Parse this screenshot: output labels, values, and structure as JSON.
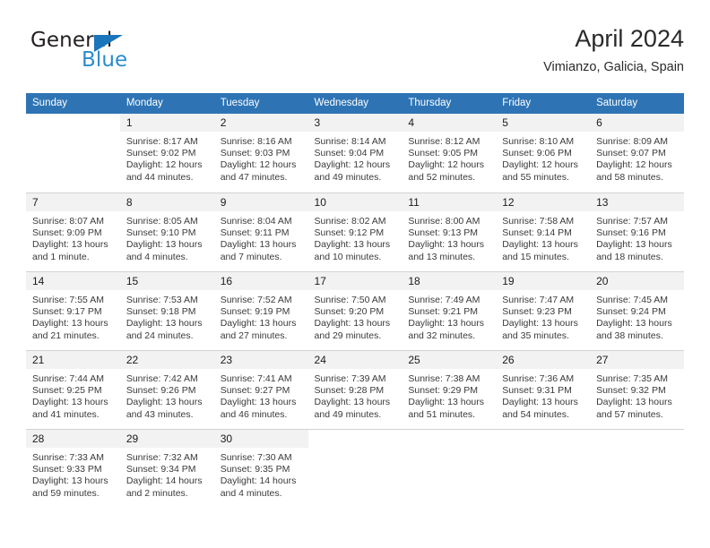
{
  "brand": {
    "name_top": "General",
    "name_bottom": "Blue",
    "triangle_color": "#1b75bb",
    "blue_color": "#2b8ccc"
  },
  "header": {
    "title": "April 2024",
    "subtitle": "Vimianzo, Galicia, Spain"
  },
  "theme": {
    "header_band": "#2e74b5",
    "daynum_band": "#f2f2f2",
    "separator": "#d2d2d2"
  },
  "weekdays": [
    "Sunday",
    "Monday",
    "Tuesday",
    "Wednesday",
    "Thursday",
    "Friday",
    "Saturday"
  ],
  "weeks": [
    [
      {
        "day": "",
        "empty": true,
        "sunrise": "",
        "sunset": "",
        "daylight_1": "",
        "daylight_2": ""
      },
      {
        "day": "1",
        "sunrise": "Sunrise: 8:17 AM",
        "sunset": "Sunset: 9:02 PM",
        "daylight_1": "Daylight: 12 hours",
        "daylight_2": "and 44 minutes."
      },
      {
        "day": "2",
        "sunrise": "Sunrise: 8:16 AM",
        "sunset": "Sunset: 9:03 PM",
        "daylight_1": "Daylight: 12 hours",
        "daylight_2": "and 47 minutes."
      },
      {
        "day": "3",
        "sunrise": "Sunrise: 8:14 AM",
        "sunset": "Sunset: 9:04 PM",
        "daylight_1": "Daylight: 12 hours",
        "daylight_2": "and 49 minutes."
      },
      {
        "day": "4",
        "sunrise": "Sunrise: 8:12 AM",
        "sunset": "Sunset: 9:05 PM",
        "daylight_1": "Daylight: 12 hours",
        "daylight_2": "and 52 minutes."
      },
      {
        "day": "5",
        "sunrise": "Sunrise: 8:10 AM",
        "sunset": "Sunset: 9:06 PM",
        "daylight_1": "Daylight: 12 hours",
        "daylight_2": "and 55 minutes."
      },
      {
        "day": "6",
        "sunrise": "Sunrise: 8:09 AM",
        "sunset": "Sunset: 9:07 PM",
        "daylight_1": "Daylight: 12 hours",
        "daylight_2": "and 58 minutes."
      }
    ],
    [
      {
        "day": "7",
        "sunrise": "Sunrise: 8:07 AM",
        "sunset": "Sunset: 9:09 PM",
        "daylight_1": "Daylight: 13 hours",
        "daylight_2": "and 1 minute."
      },
      {
        "day": "8",
        "sunrise": "Sunrise: 8:05 AM",
        "sunset": "Sunset: 9:10 PM",
        "daylight_1": "Daylight: 13 hours",
        "daylight_2": "and 4 minutes."
      },
      {
        "day": "9",
        "sunrise": "Sunrise: 8:04 AM",
        "sunset": "Sunset: 9:11 PM",
        "daylight_1": "Daylight: 13 hours",
        "daylight_2": "and 7 minutes."
      },
      {
        "day": "10",
        "sunrise": "Sunrise: 8:02 AM",
        "sunset": "Sunset: 9:12 PM",
        "daylight_1": "Daylight: 13 hours",
        "daylight_2": "and 10 minutes."
      },
      {
        "day": "11",
        "sunrise": "Sunrise: 8:00 AM",
        "sunset": "Sunset: 9:13 PM",
        "daylight_1": "Daylight: 13 hours",
        "daylight_2": "and 13 minutes."
      },
      {
        "day": "12",
        "sunrise": "Sunrise: 7:58 AM",
        "sunset": "Sunset: 9:14 PM",
        "daylight_1": "Daylight: 13 hours",
        "daylight_2": "and 15 minutes."
      },
      {
        "day": "13",
        "sunrise": "Sunrise: 7:57 AM",
        "sunset": "Sunset: 9:16 PM",
        "daylight_1": "Daylight: 13 hours",
        "daylight_2": "and 18 minutes."
      }
    ],
    [
      {
        "day": "14",
        "sunrise": "Sunrise: 7:55 AM",
        "sunset": "Sunset: 9:17 PM",
        "daylight_1": "Daylight: 13 hours",
        "daylight_2": "and 21 minutes."
      },
      {
        "day": "15",
        "sunrise": "Sunrise: 7:53 AM",
        "sunset": "Sunset: 9:18 PM",
        "daylight_1": "Daylight: 13 hours",
        "daylight_2": "and 24 minutes."
      },
      {
        "day": "16",
        "sunrise": "Sunrise: 7:52 AM",
        "sunset": "Sunset: 9:19 PM",
        "daylight_1": "Daylight: 13 hours",
        "daylight_2": "and 27 minutes."
      },
      {
        "day": "17",
        "sunrise": "Sunrise: 7:50 AM",
        "sunset": "Sunset: 9:20 PM",
        "daylight_1": "Daylight: 13 hours",
        "daylight_2": "and 29 minutes."
      },
      {
        "day": "18",
        "sunrise": "Sunrise: 7:49 AM",
        "sunset": "Sunset: 9:21 PM",
        "daylight_1": "Daylight: 13 hours",
        "daylight_2": "and 32 minutes."
      },
      {
        "day": "19",
        "sunrise": "Sunrise: 7:47 AM",
        "sunset": "Sunset: 9:23 PM",
        "daylight_1": "Daylight: 13 hours",
        "daylight_2": "and 35 minutes."
      },
      {
        "day": "20",
        "sunrise": "Sunrise: 7:45 AM",
        "sunset": "Sunset: 9:24 PM",
        "daylight_1": "Daylight: 13 hours",
        "daylight_2": "and 38 minutes."
      }
    ],
    [
      {
        "day": "21",
        "sunrise": "Sunrise: 7:44 AM",
        "sunset": "Sunset: 9:25 PM",
        "daylight_1": "Daylight: 13 hours",
        "daylight_2": "and 41 minutes."
      },
      {
        "day": "22",
        "sunrise": "Sunrise: 7:42 AM",
        "sunset": "Sunset: 9:26 PM",
        "daylight_1": "Daylight: 13 hours",
        "daylight_2": "and 43 minutes."
      },
      {
        "day": "23",
        "sunrise": "Sunrise: 7:41 AM",
        "sunset": "Sunset: 9:27 PM",
        "daylight_1": "Daylight: 13 hours",
        "daylight_2": "and 46 minutes."
      },
      {
        "day": "24",
        "sunrise": "Sunrise: 7:39 AM",
        "sunset": "Sunset: 9:28 PM",
        "daylight_1": "Daylight: 13 hours",
        "daylight_2": "and 49 minutes."
      },
      {
        "day": "25",
        "sunrise": "Sunrise: 7:38 AM",
        "sunset": "Sunset: 9:29 PM",
        "daylight_1": "Daylight: 13 hours",
        "daylight_2": "and 51 minutes."
      },
      {
        "day": "26",
        "sunrise": "Sunrise: 7:36 AM",
        "sunset": "Sunset: 9:31 PM",
        "daylight_1": "Daylight: 13 hours",
        "daylight_2": "and 54 minutes."
      },
      {
        "day": "27",
        "sunrise": "Sunrise: 7:35 AM",
        "sunset": "Sunset: 9:32 PM",
        "daylight_1": "Daylight: 13 hours",
        "daylight_2": "and 57 minutes."
      }
    ],
    [
      {
        "day": "28",
        "sunrise": "Sunrise: 7:33 AM",
        "sunset": "Sunset: 9:33 PM",
        "daylight_1": "Daylight: 13 hours",
        "daylight_2": "and 59 minutes."
      },
      {
        "day": "29",
        "sunrise": "Sunrise: 7:32 AM",
        "sunset": "Sunset: 9:34 PM",
        "daylight_1": "Daylight: 14 hours",
        "daylight_2": "and 2 minutes."
      },
      {
        "day": "30",
        "sunrise": "Sunrise: 7:30 AM",
        "sunset": "Sunset: 9:35 PM",
        "daylight_1": "Daylight: 14 hours",
        "daylight_2": "and 4 minutes."
      },
      {
        "day": "",
        "empty": true,
        "sunrise": "",
        "sunset": "",
        "daylight_1": "",
        "daylight_2": ""
      },
      {
        "day": "",
        "empty": true,
        "sunrise": "",
        "sunset": "",
        "daylight_1": "",
        "daylight_2": ""
      },
      {
        "day": "",
        "empty": true,
        "sunrise": "",
        "sunset": "",
        "daylight_1": "",
        "daylight_2": ""
      },
      {
        "day": "",
        "empty": true,
        "sunrise": "",
        "sunset": "",
        "daylight_1": "",
        "daylight_2": ""
      }
    ]
  ]
}
